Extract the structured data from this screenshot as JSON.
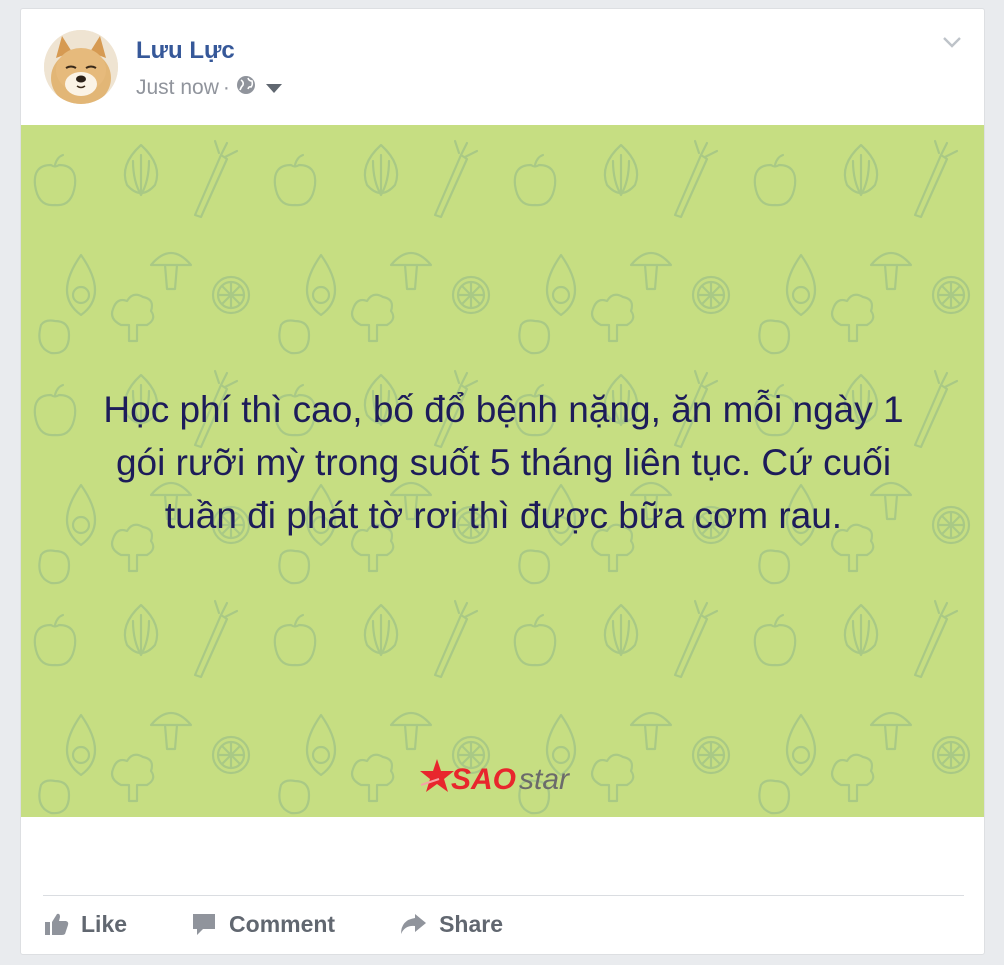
{
  "post": {
    "author_name": "Lưu Lực",
    "timestamp": "Just now",
    "separator": "·",
    "audience_icon": "globe-icon",
    "options_icon": "chevron-down-icon",
    "avatar_icon": "shiba-dog-avatar",
    "content_text": "Học phí thì cao, bố đổ bệnh nặng, ăn mỗi ngày 1 gói rưỡi mỳ trong suốt 5 tháng liên tục. Cứ cuối tuần đi phát tờ rơi thì được bữa cơm rau.",
    "background": {
      "color": "#c6de82",
      "pattern": "vegetable-doodle-pattern",
      "pattern_color": "#9fc07a"
    },
    "watermark": {
      "sao_text": "SAO",
      "star_text": "star",
      "sao_color": "#e8262d",
      "star_color": "#6b6b6b"
    }
  },
  "actions": {
    "like_label": "Like",
    "comment_label": "Comment",
    "share_label": "Share",
    "like_icon": "thumbs-up-icon",
    "comment_icon": "speech-bubble-icon",
    "share_icon": "share-arrow-icon"
  },
  "colors": {
    "author_link": "#365899",
    "meta_text": "#90949c",
    "action_text": "#616770",
    "post_text": "#1d1c5a"
  }
}
